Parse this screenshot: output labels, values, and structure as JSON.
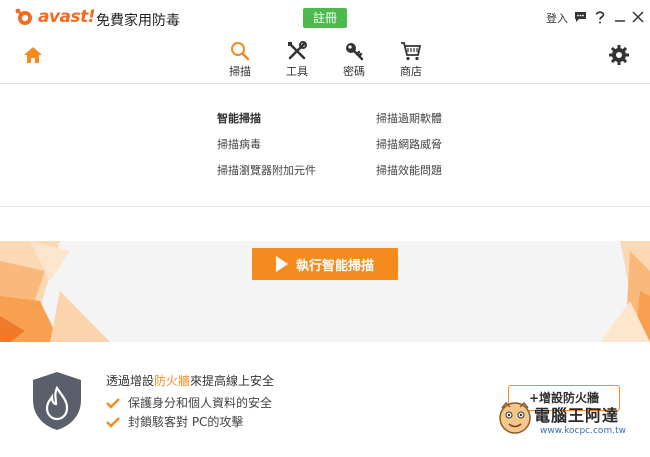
{
  "app": {
    "brand_mark": "avast!",
    "title": "免費家用防毒",
    "register_label": "註冊",
    "login_label": "登入"
  },
  "nav": {
    "items": [
      {
        "label": "掃描",
        "icon": "search-icon",
        "active": true
      },
      {
        "label": "工具",
        "icon": "tools-icon",
        "active": false
      },
      {
        "label": "密碼",
        "icon": "key-icon",
        "active": false
      },
      {
        "label": "商店",
        "icon": "cart-icon",
        "active": false
      }
    ]
  },
  "scan_menu": {
    "left": [
      "智能掃描",
      "掃描病毒",
      "掃描瀏覽器附加元件"
    ],
    "right": [
      "掃描過期軟體",
      "掃描網路威脅",
      "掃描效能問題"
    ]
  },
  "banner": {
    "run_button": "執行智能掃描"
  },
  "promo": {
    "title_prefix": "透過增設",
    "title_highlight": "防火牆",
    "title_suffix": "來提高線上安全",
    "benefits": [
      "保護身分和個人資料的安全",
      "封鎖駭客對 PC的攻擊"
    ],
    "button": "+增設防火牆"
  },
  "watermark": {
    "text": "電腦王阿達",
    "url": "www.kocpc.com.tw"
  },
  "colors": {
    "accent_orange": "#f58a1f",
    "register_green": "#4cba4c",
    "text_dark": "#333333"
  }
}
